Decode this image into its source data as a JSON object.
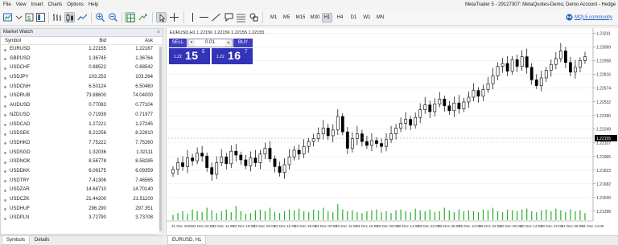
{
  "menu": [
    "File",
    "View",
    "Insert",
    "Charts",
    "Options",
    "Help"
  ],
  "window_title": "MetaTrader 5 - 29127307: MetaQuotes-Demo, Demo Account - Hedge",
  "timeframes": [
    "M1",
    "M5",
    "M15",
    "M30",
    "H1",
    "H4",
    "D1",
    "W1",
    "MN"
  ],
  "active_timeframe": "H1",
  "mql_link": "MQL5.community",
  "market_watch": {
    "title": "Market Watch",
    "columns": {
      "symbol": "Symbol",
      "bid": "Bid",
      "ask": "Ask"
    },
    "rows": [
      {
        "symbol": "EURUSD",
        "bid": "1.22155",
        "ask": "1.22167"
      },
      {
        "symbol": "GBPUSD",
        "bid": "1.36745",
        "ask": "1.36764"
      },
      {
        "symbol": "USDCHF",
        "bid": "0.88522",
        "ask": "0.88542"
      },
      {
        "symbol": "USDJPY",
        "bid": "103.253",
        "ask": "103.264"
      },
      {
        "symbol": "USDCNH",
        "bid": "6.50124",
        "ask": "6.50460"
      },
      {
        "symbol": "USDRUB",
        "bid": "73.88600",
        "ask": "74.04000"
      },
      {
        "symbol": "AUDUSD",
        "bid": "0.77083",
        "ask": "0.77104"
      },
      {
        "symbol": "NZDUSD",
        "bid": "0.71939",
        "ask": "0.71977"
      },
      {
        "symbol": "USDCAD",
        "bid": "1.27221",
        "ask": "1.27245"
      },
      {
        "symbol": "USDSEK",
        "bid": "8.22256",
        "ask": "8.22810"
      },
      {
        "symbol": "USDHKD",
        "bid": "7.75222",
        "ask": "7.75260"
      },
      {
        "symbol": "USDSGD",
        "bid": "1.32036",
        "ask": "1.32111"
      },
      {
        "symbol": "USDNOK",
        "bid": "8.56778",
        "ask": "8.58285"
      },
      {
        "symbol": "USDDKK",
        "bid": "6.09175",
        "ask": "6.09359"
      },
      {
        "symbol": "USDTRY",
        "bid": "7.41306",
        "ask": "7.46565"
      },
      {
        "symbol": "USDZAR",
        "bid": "14.68710",
        "ask": "14.70140"
      },
      {
        "symbol": "USDCZK",
        "bid": "21.44200",
        "ask": "21.51100"
      },
      {
        "symbol": "USDHUF",
        "bid": "296.290",
        "ask": "297.351"
      },
      {
        "symbol": "USDPLN",
        "bid": "3.72790",
        "ask": "3.73708"
      }
    ],
    "tabs": [
      "Symbols",
      "Details"
    ],
    "active_tab": "Symbols"
  },
  "chart": {
    "header": "EURUSD,H1  1.22156 1.22156 1.22155 1.22155",
    "tab": "EURUSD, H1",
    "one_click": {
      "sell_label": "SELL",
      "buy_label": "BUY",
      "lot": "0.01",
      "sell_prefix": "1.22",
      "sell_big": "15",
      "sell_sup": "5",
      "buy_prefix": "1.22",
      "buy_big": "16",
      "buy_sup": "7"
    },
    "current_price": "1.22155",
    "price_color": "#000000"
  },
  "chart_data": {
    "type": "candlestick",
    "symbol": "EURUSD",
    "timeframe": "H1",
    "y_ticks": [
      "1.23241",
      "1.23099",
      "1.22958",
      "1.22816",
      "1.22674",
      "1.22532",
      "1.22390",
      "1.22249",
      "1.22107",
      "1.21965",
      "1.21823",
      "1.21682",
      "1.21540",
      "1.21398"
    ],
    "ylim": [
      1.2133,
      1.2328
    ],
    "x_ticks": [
      "21 Dec 2020",
      "22 Dec 03:00",
      "22 Dec 11:00",
      "22 Dec 19:00",
      "23 Dec 03:00",
      "23 Dec 11:00",
      "23 Dec 19:00",
      "24 Dec 03:00",
      "24 Dec 11:00",
      "24 Dec 19:00",
      "28 Dec 06:00",
      "28 Dec 14:00",
      "28 Dec 22:00",
      "29 Dec 06:00",
      "29 Dec 14:00",
      "29 Dec 22:00",
      "30 Dec 06:00",
      "30 Dec 14:00",
      "30 Dec 22:00",
      "31 Dec 06:00",
      "31 Dec 14:00"
    ],
    "closes": [
      1.2183,
      1.219,
      1.2186,
      1.2195,
      1.2192,
      1.22,
      1.2197,
      1.2185,
      1.2178,
      1.219,
      1.2196,
      1.2189,
      1.2202,
      1.2198,
      1.2193,
      1.2187,
      1.2195,
      1.219,
      1.2199,
      1.2205,
      1.2194,
      1.2186,
      1.218,
      1.2188,
      1.2196,
      1.2203,
      1.2199,
      1.2207,
      1.2212,
      1.2215,
      1.222,
      1.2226,
      1.2218,
      1.2224,
      1.2238,
      1.2222,
      1.2205,
      1.2215,
      1.222,
      1.2212,
      1.2208,
      1.2213,
      1.221,
      1.2207,
      1.2214,
      1.222,
      1.2226,
      1.2231,
      1.2235,
      1.2229,
      1.2237,
      1.2245,
      1.225,
      1.2243,
      1.2251,
      1.2256,
      1.2249,
      1.2244,
      1.2252,
      1.2246,
      1.2253,
      1.2258,
      1.2265,
      1.2259,
      1.2266,
      1.2272,
      1.228,
      1.229,
      1.2293,
      1.2285,
      1.2297,
      1.229,
      1.23,
      1.2289,
      1.2276,
      1.227,
      1.2278,
      1.2286,
      1.2292,
      1.2298,
      1.2306,
      1.2294,
      1.2284,
      1.2289,
      1.2296,
      1.23
    ],
    "volume_relative": [
      0.3,
      0.4,
      0.5,
      0.35,
      0.6,
      0.5,
      0.45,
      0.7,
      0.55,
      0.4,
      0.5,
      0.6,
      0.45,
      0.8,
      0.5,
      0.35,
      0.4,
      0.55,
      0.6,
      0.5,
      0.7,
      0.45,
      0.4,
      0.5,
      0.6,
      0.55,
      0.65,
      0.5,
      0.45,
      0.6,
      0.55,
      0.7,
      0.5,
      0.45,
      0.9,
      0.6,
      0.5,
      0.55,
      0.45,
      0.4,
      0.5,
      0.55,
      0.6,
      0.45,
      0.5,
      0.4,
      0.55,
      0.6,
      0.5,
      0.45,
      0.65,
      0.55,
      0.5,
      0.6,
      0.45,
      0.5,
      0.7,
      0.55,
      0.45,
      0.6,
      0.5,
      0.55,
      0.5,
      0.45,
      0.6,
      0.55,
      0.7,
      0.5,
      0.45,
      0.6,
      0.55,
      0.5,
      0.6,
      0.65,
      0.5,
      0.45,
      0.55,
      0.6,
      0.5,
      0.65,
      0.55,
      0.45,
      0.6,
      0.5,
      0.55,
      0.4
    ]
  }
}
